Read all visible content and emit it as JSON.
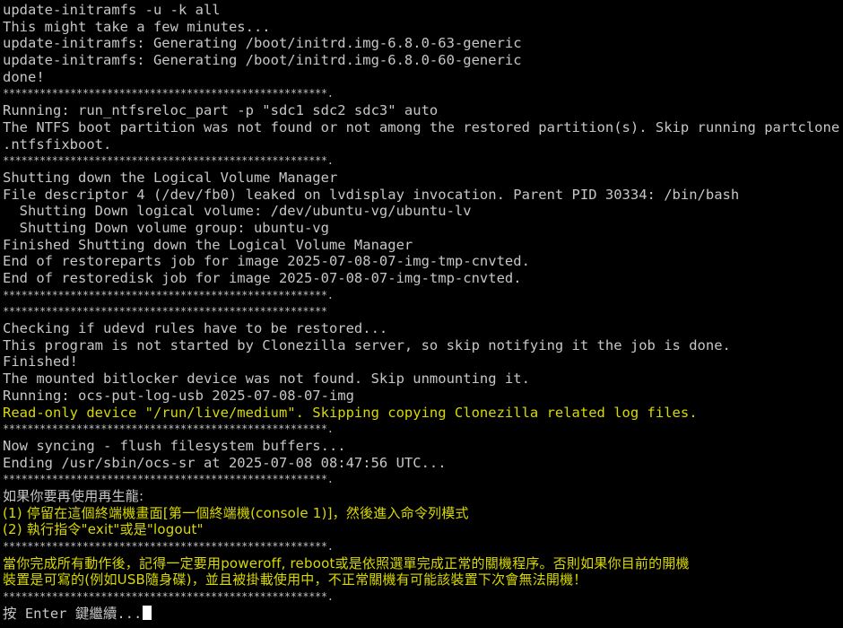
{
  "colors": {
    "background": "#000000",
    "text": "#c6c6c6",
    "warning": "#d9d900",
    "cursor": "#ffffff"
  },
  "terminal": {
    "lines": [
      {
        "text": "update-initramfs -u -k all",
        "style": "normal"
      },
      {
        "text": "This might take a few minutes...",
        "style": "normal"
      },
      {
        "text": "update-initramfs: Generating /boot/initrd.img-6.8.0-63-generic",
        "style": "normal"
      },
      {
        "text": "update-initramfs: Generating /boot/initrd.img-6.8.0-60-generic",
        "style": "normal"
      },
      {
        "text": "done!",
        "style": "normal"
      },
      {
        "text": "*****************************************************.",
        "style": "rule"
      },
      {
        "text": "Running: run_ntfsreloc_part -p \"sdc1 sdc2 sdc3\" auto",
        "style": "normal"
      },
      {
        "text": "The NTFS boot partition was not found or not among the restored partition(s). Skip running partclone",
        "style": "normal"
      },
      {
        "text": ".ntfsfixboot.",
        "style": "normal"
      },
      {
        "text": "*****************************************************.",
        "style": "rule"
      },
      {
        "text": "Shutting down the Logical Volume Manager",
        "style": "normal"
      },
      {
        "text": "File descriptor 4 (/dev/fb0) leaked on lvdisplay invocation. Parent PID 30334: /bin/bash",
        "style": "normal"
      },
      {
        "text": "  Shutting Down logical volume: /dev/ubuntu-vg/ubuntu-lv",
        "style": "normal"
      },
      {
        "text": "  Shutting Down volume group: ubuntu-vg",
        "style": "normal"
      },
      {
        "text": "Finished Shutting down the Logical Volume Manager",
        "style": "normal"
      },
      {
        "text": "End of restoreparts job for image 2025-07-08-07-img-tmp-cnvted.",
        "style": "normal"
      },
      {
        "text": "End of restoredisk job for image 2025-07-08-07-img-tmp-cnvted.",
        "style": "normal"
      },
      {
        "text": "*****************************************************.",
        "style": "rule"
      },
      {
        "text": "*****************************************************",
        "style": "rule"
      },
      {
        "text": "Checking if udevd rules have to be restored...",
        "style": "normal"
      },
      {
        "text": "This program is not started by Clonezilla server, so skip notifying it the job is done.",
        "style": "normal"
      },
      {
        "text": "Finished!",
        "style": "normal"
      },
      {
        "text": "The mounted bitlocker device was not found. Skip unmounting it.",
        "style": "normal"
      },
      {
        "text": "Running: ocs-put-log-usb 2025-07-08-07-img",
        "style": "normal"
      },
      {
        "text": "Read-only device \"/run/live/medium\". Skipping copying Clonezilla related log files.",
        "style": "yellow"
      },
      {
        "text": "*****************************************************.",
        "style": "rule"
      },
      {
        "text": "Now syncing - flush filesystem buffers...",
        "style": "normal"
      },
      {
        "text": "Ending /usr/sbin/ocs-sr at 2025-07-08 08:47:56 UTC...",
        "style": "normal"
      },
      {
        "text": "*****************************************************.",
        "style": "rule"
      },
      {
        "text": "如果你要再使用再生龍:",
        "style": "cjk"
      },
      {
        "text": "(1) 停留在這個終端機畫面[第一個終端機(console 1)]，然後進入命令列模式",
        "style": "cjk-yellow"
      },
      {
        "text": "(2) 執行指令\"exit\"或是\"logout\"",
        "style": "cjk-yellow"
      },
      {
        "text": "*****************************************************.",
        "style": "rule"
      },
      {
        "text": "當你完成所有動作後，記得一定要用poweroff, reboot或是依照選單完成正常的關機程序。否則如果你目前的開機",
        "style": "cjk-yellow"
      },
      {
        "text": "裝置是可寫的(例如USB隨身碟)，並且被掛載使用中，不正常關機有可能該裝置下次會無法開機！",
        "style": "cjk-yellow"
      },
      {
        "text": "*****************************************************.",
        "style": "rule"
      }
    ],
    "prompt": "按 Enter 鍵繼續..."
  }
}
